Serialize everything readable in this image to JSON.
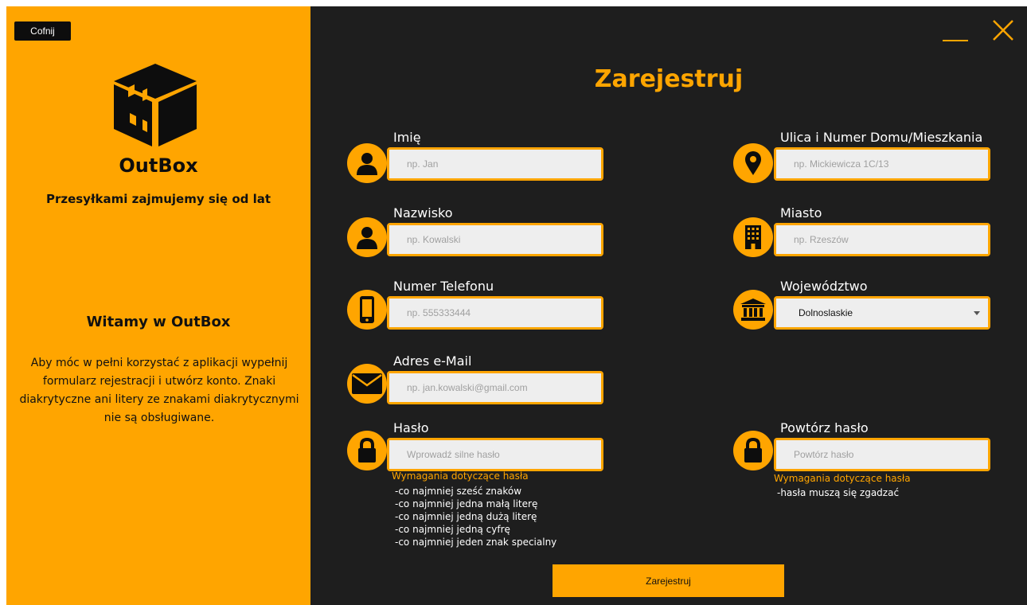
{
  "left_panel": {
    "back_label": "Cofnij",
    "brand": "OutBox",
    "slogan": "Przesyłkami zajmujemy się od lat",
    "welcome": "Witamy w OutBox",
    "description": "Aby móc w pełni korzystać z aplikacji wypełnij formularz rejestracji i utwórz konto. Znaki diakrytyczne ani litery ze znakami diakrytycznymi nie są obsługiwane."
  },
  "title": "Zarejestruj",
  "fields": {
    "first_name": {
      "label": "Imię",
      "placeholder": "np. Jan",
      "icon": "user-icon"
    },
    "last_name": {
      "label": "Nazwisko",
      "placeholder": "np. Kowalski",
      "icon": "user-icon"
    },
    "phone": {
      "label": "Numer Telefonu",
      "placeholder": "np. 555333444",
      "icon": "phone-icon"
    },
    "email": {
      "label": "Adres e-Mail",
      "placeholder": "np. jan.kowalski@gmail.com",
      "icon": "envelope-icon"
    },
    "password": {
      "label": "Hasło",
      "placeholder": "Wprowadź silne hasło",
      "icon": "lock-icon"
    },
    "street": {
      "label": "Ulica i Numer Domu/Mieszkania",
      "placeholder": "np. Mickiewicza 1C/13",
      "icon": "map-pin-icon"
    },
    "city": {
      "label": "Miasto",
      "placeholder": "np. Rzeszów",
      "icon": "building-icon"
    },
    "voivodeship": {
      "label": "Województwo",
      "value": "Dolnoslaskie",
      "icon": "institution-icon"
    },
    "repeat_password": {
      "label": "Powtórz hasło",
      "placeholder": "Powtórz hasło",
      "icon": "lock-icon"
    }
  },
  "password_requirements": {
    "title": "Wymagania dotyczące hasła",
    "items": [
      "-co najmniej sześć znaków",
      "-co najmniej jedna małą literę",
      "-co najmniej jedną dużą literę",
      "-co najmniej jedną cyfrę",
      "-co najmniej jeden znak specialny"
    ]
  },
  "repeat_requirements": {
    "title": "Wymagania dotyczące hasła",
    "items": [
      "-hasła muszą się zgadzać"
    ]
  },
  "submit_label": "Zarejestruj",
  "colors": {
    "accent": "#ffa500",
    "background": "#1e1e1e",
    "input_bg": "#eeeeee"
  }
}
